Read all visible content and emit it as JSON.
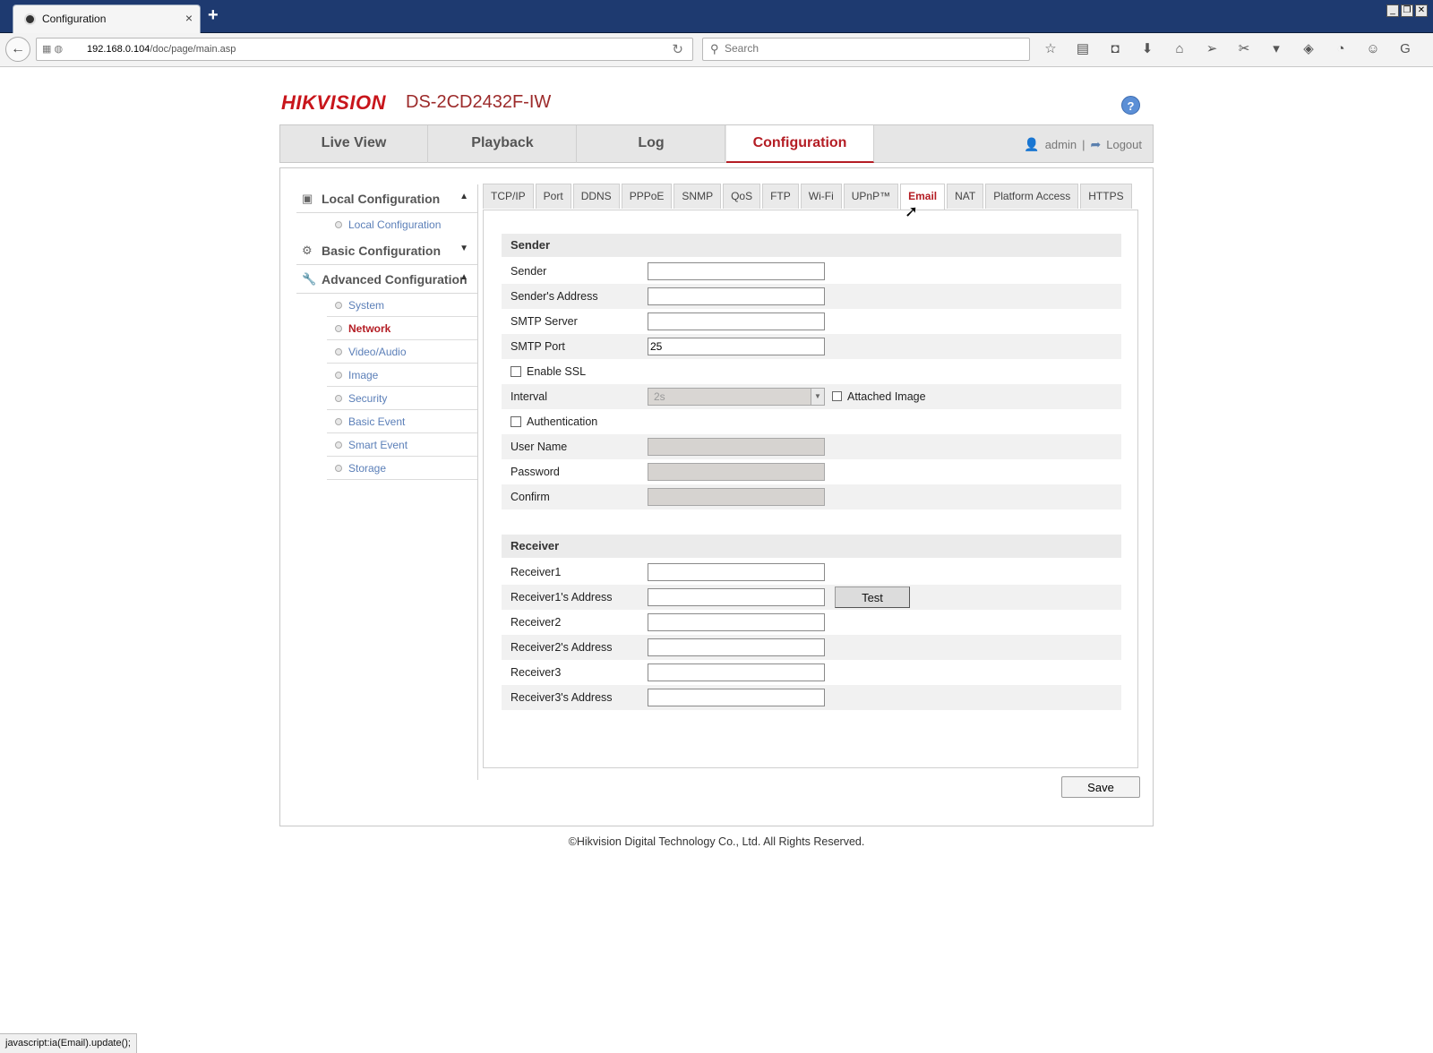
{
  "browser": {
    "tab_title": "Configuration",
    "tab_close": "×",
    "new_tab": "+",
    "url_host": "192.168.0.104",
    "url_path": "/doc/page/main.asp",
    "search_placeholder": "Search",
    "status_text": "javascript:ia(Email).update();"
  },
  "header": {
    "logo": "HIKVISION",
    "model": "DS-2CD2432F-IW",
    "help": "?"
  },
  "mainnav": {
    "tabs": [
      "Live View",
      "Playback",
      "Log",
      "Configuration"
    ],
    "active": "Configuration",
    "user": "admin",
    "separator": "|",
    "logout": "Logout"
  },
  "sidebar": {
    "local": {
      "label": "Local Configuration",
      "items": [
        "Local Configuration"
      ]
    },
    "basic": {
      "label": "Basic Configuration"
    },
    "advanced": {
      "label": "Advanced Configuration",
      "items": [
        "System",
        "Network",
        "Video/Audio",
        "Image",
        "Security",
        "Basic Event",
        "Smart Event",
        "Storage"
      ],
      "active": "Network"
    }
  },
  "subtabs": {
    "items": [
      "TCP/IP",
      "Port",
      "DDNS",
      "PPPoE",
      "SNMP",
      "QoS",
      "FTP",
      "Wi-Fi",
      "UPnP™",
      "Email",
      "NAT",
      "Platform Access",
      "HTTPS"
    ],
    "active": "Email"
  },
  "sender": {
    "title": "Sender",
    "sender_label": "Sender",
    "sender_value": "",
    "address_label": "Sender's Address",
    "address_value": "",
    "smtp_server_label": "SMTP Server",
    "smtp_server_value": "",
    "smtp_port_label": "SMTP Port",
    "smtp_port_value": "25",
    "ssl_label": "Enable SSL",
    "interval_label": "Interval",
    "interval_value": "2s",
    "attached_label": "Attached Image",
    "auth_label": "Authentication",
    "username_label": "User Name",
    "password_label": "Password",
    "confirm_label": "Confirm"
  },
  "receiver": {
    "title": "Receiver",
    "r1_label": "Receiver1",
    "r1_addr_label": "Receiver1's Address",
    "r2_label": "Receiver2",
    "r2_addr_label": "Receiver2's Address",
    "r3_label": "Receiver3",
    "r3_addr_label": "Receiver3's Address",
    "test_label": "Test"
  },
  "actions": {
    "save_label": "Save"
  },
  "footer": {
    "copyright": "©Hikvision Digital Technology Co., Ltd. All Rights Reserved."
  }
}
